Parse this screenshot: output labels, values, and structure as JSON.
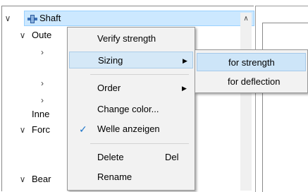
{
  "tree": {
    "shaft_label": "Shaft",
    "outer_label": "Oute",
    "inner_label": "Inne",
    "forc_label": "Forc",
    "bear_label": "Bear"
  },
  "context_menu": {
    "items": [
      {
        "label": "Verify strength"
      },
      {
        "label": "Sizing",
        "submenu": true,
        "highlighted": true
      },
      {
        "label": "Order",
        "submenu": true
      },
      {
        "label": "Change color..."
      },
      {
        "label": "Welle anzeigen",
        "checked": true
      },
      {
        "label": "Delete",
        "shortcut": "Del"
      },
      {
        "label": "Rename"
      }
    ]
  },
  "submenu": {
    "items": [
      {
        "label": "for strength",
        "highlighted": true
      },
      {
        "label": "for deflection"
      }
    ]
  },
  "colors": {
    "selection": "#cce8ff",
    "menu_highlight": "#d5e8f7",
    "check": "#1a73c8"
  }
}
